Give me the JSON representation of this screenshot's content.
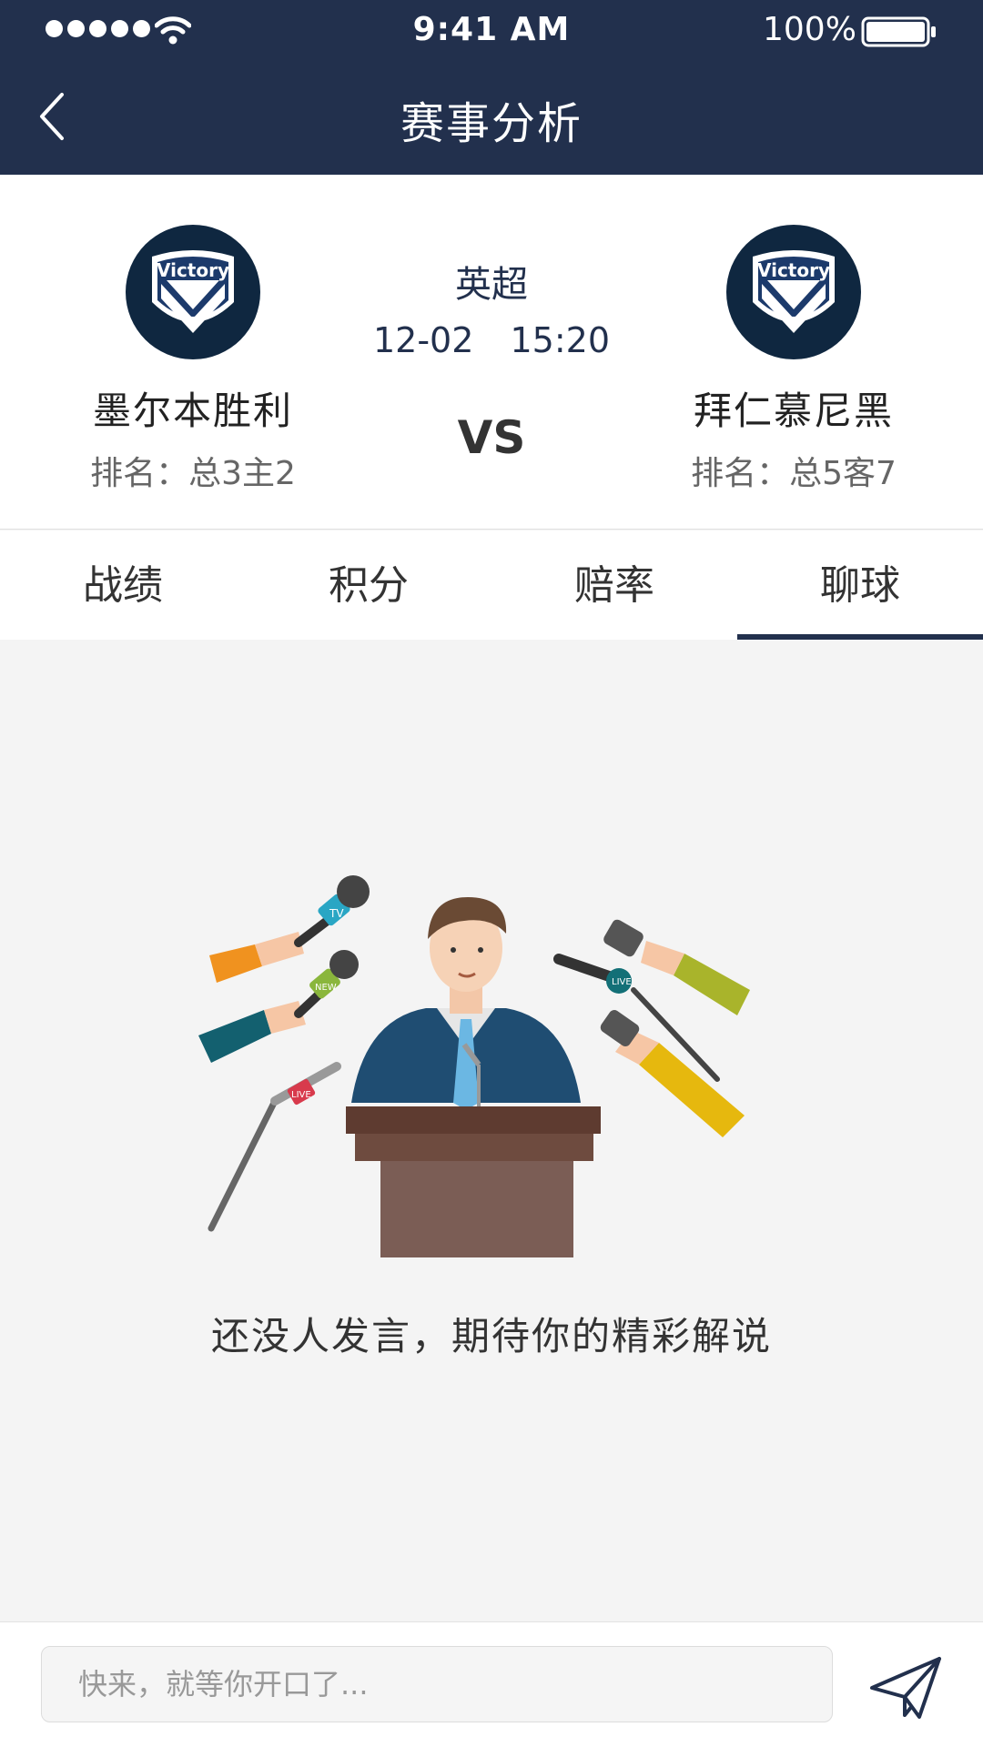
{
  "status_bar": {
    "time": "9:41 AM",
    "battery": "100%"
  },
  "nav": {
    "title": "赛事分析"
  },
  "match": {
    "league": "英超",
    "date": "12-02",
    "time": "15:20",
    "vs": "VS",
    "home": {
      "name": "墨尔本胜利",
      "rank": "排名：总3主2",
      "badge_text": "Victory"
    },
    "away": {
      "name": "拜仁慕尼黑",
      "rank": "排名：总5客7",
      "badge_text": "Victory"
    }
  },
  "tabs": [
    {
      "label": "战绩"
    },
    {
      "label": "积分"
    },
    {
      "label": "赔率"
    },
    {
      "label": "聊球",
      "active": true
    }
  ],
  "empty_state": {
    "message": "还没人发言，期待你的精彩解说",
    "mic_labels": [
      "TV",
      "NEW",
      "LIVE",
      "LIVE"
    ]
  },
  "chat": {
    "placeholder": "快来，就等你开口了..."
  },
  "colors": {
    "nav_bg": "#22304d",
    "accent": "#22304d",
    "page_bg": "#f4f4f4"
  }
}
